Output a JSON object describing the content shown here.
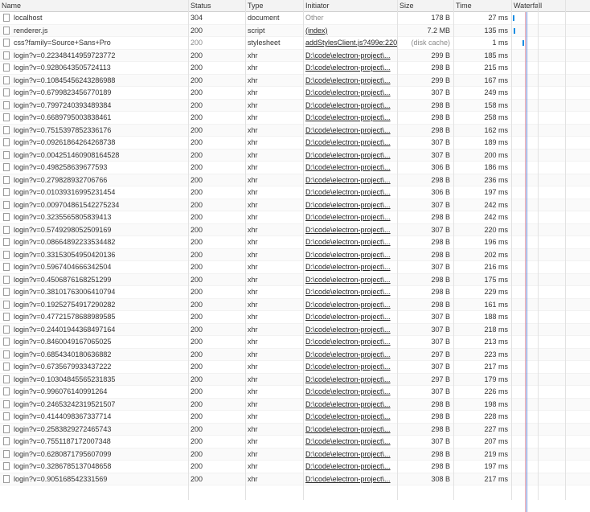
{
  "columns": [
    "Name",
    "Status",
    "Type",
    "Initiator",
    "Size",
    "Time",
    "Waterfall"
  ],
  "requests": [
    {
      "name": "localhost",
      "status": "304",
      "type": "document",
      "initiator": "Other",
      "initiator_link": false,
      "size": "178 B",
      "time": "27 ms"
    },
    {
      "name": "renderer.js",
      "status": "200",
      "type": "script",
      "initiator": "(index)",
      "initiator_link": true,
      "size": "7.2 MB",
      "time": "135 ms"
    },
    {
      "name": "css?family=Source+Sans+Pro",
      "status": "200",
      "type": "stylesheet",
      "initiator": "addStylesClient.js?499e:220",
      "initiator_link": true,
      "size": "(disk cache)",
      "time": "1 ms",
      "muted": true
    },
    {
      "name": "login?v=0.22348414959723772",
      "status": "200",
      "type": "xhr",
      "initiator": "D:\\code\\electron-project\\...",
      "initiator_link": true,
      "size": "299 B",
      "time": "185 ms"
    },
    {
      "name": "login?v=0.9280643505724113",
      "status": "200",
      "type": "xhr",
      "initiator": "D:\\code\\electron-project\\...",
      "initiator_link": true,
      "size": "298 B",
      "time": "215 ms"
    },
    {
      "name": "login?v=0.10845456243286988",
      "status": "200",
      "type": "xhr",
      "initiator": "D:\\code\\electron-project\\...",
      "initiator_link": true,
      "size": "299 B",
      "time": "167 ms"
    },
    {
      "name": "login?v=0.6799823456770189",
      "status": "200",
      "type": "xhr",
      "initiator": "D:\\code\\electron-project\\...",
      "initiator_link": true,
      "size": "307 B",
      "time": "249 ms"
    },
    {
      "name": "login?v=0.7997240393489384",
      "status": "200",
      "type": "xhr",
      "initiator": "D:\\code\\electron-project\\...",
      "initiator_link": true,
      "size": "298 B",
      "time": "158 ms"
    },
    {
      "name": "login?v=0.6689795003838461",
      "status": "200",
      "type": "xhr",
      "initiator": "D:\\code\\electron-project\\...",
      "initiator_link": true,
      "size": "298 B",
      "time": "258 ms"
    },
    {
      "name": "login?v=0.7515397852336176",
      "status": "200",
      "type": "xhr",
      "initiator": "D:\\code\\electron-project\\...",
      "initiator_link": true,
      "size": "298 B",
      "time": "162 ms"
    },
    {
      "name": "login?v=0.09261864264268738",
      "status": "200",
      "type": "xhr",
      "initiator": "D:\\code\\electron-project\\...",
      "initiator_link": true,
      "size": "307 B",
      "time": "189 ms"
    },
    {
      "name": "login?v=0.004251460908164528",
      "status": "200",
      "type": "xhr",
      "initiator": "D:\\code\\electron-project\\...",
      "initiator_link": true,
      "size": "307 B",
      "time": "200 ms"
    },
    {
      "name": "login?v=0.498258639677593",
      "status": "200",
      "type": "xhr",
      "initiator": "D:\\code\\electron-project\\...",
      "initiator_link": true,
      "size": "306 B",
      "time": "186 ms"
    },
    {
      "name": "login?v=0.279828932706766",
      "status": "200",
      "type": "xhr",
      "initiator": "D:\\code\\electron-project\\...",
      "initiator_link": true,
      "size": "298 B",
      "time": "236 ms"
    },
    {
      "name": "login?v=0.01039316995231454",
      "status": "200",
      "type": "xhr",
      "initiator": "D:\\code\\electron-project\\...",
      "initiator_link": true,
      "size": "306 B",
      "time": "197 ms"
    },
    {
      "name": "login?v=0.009704861542275234",
      "status": "200",
      "type": "xhr",
      "initiator": "D:\\code\\electron-project\\...",
      "initiator_link": true,
      "size": "307 B",
      "time": "242 ms"
    },
    {
      "name": "login?v=0.3235565805839413",
      "status": "200",
      "type": "xhr",
      "initiator": "D:\\code\\electron-project\\...",
      "initiator_link": true,
      "size": "298 B",
      "time": "242 ms"
    },
    {
      "name": "login?v=0.5749298052509169",
      "status": "200",
      "type": "xhr",
      "initiator": "D:\\code\\electron-project\\...",
      "initiator_link": true,
      "size": "307 B",
      "time": "220 ms"
    },
    {
      "name": "login?v=0.08664892233534482",
      "status": "200",
      "type": "xhr",
      "initiator": "D:\\code\\electron-project\\...",
      "initiator_link": true,
      "size": "298 B",
      "time": "196 ms"
    },
    {
      "name": "login?v=0.33153054950420136",
      "status": "200",
      "type": "xhr",
      "initiator": "D:\\code\\electron-project\\...",
      "initiator_link": true,
      "size": "298 B",
      "time": "202 ms"
    },
    {
      "name": "login?v=0.5967404666342504",
      "status": "200",
      "type": "xhr",
      "initiator": "D:\\code\\electron-project\\...",
      "initiator_link": true,
      "size": "307 B",
      "time": "216 ms"
    },
    {
      "name": "login?v=0.4506876168251299",
      "status": "200",
      "type": "xhr",
      "initiator": "D:\\code\\electron-project\\...",
      "initiator_link": true,
      "size": "298 B",
      "time": "175 ms"
    },
    {
      "name": "login?v=0.38101763006410794",
      "status": "200",
      "type": "xhr",
      "initiator": "D:\\code\\electron-project\\...",
      "initiator_link": true,
      "size": "298 B",
      "time": "229 ms"
    },
    {
      "name": "login?v=0.19252754917290282",
      "status": "200",
      "type": "xhr",
      "initiator": "D:\\code\\electron-project\\...",
      "initiator_link": true,
      "size": "298 B",
      "time": "161 ms"
    },
    {
      "name": "login?v=0.47721578688989585",
      "status": "200",
      "type": "xhr",
      "initiator": "D:\\code\\electron-project\\...",
      "initiator_link": true,
      "size": "307 B",
      "time": "188 ms"
    },
    {
      "name": "login?v=0.24401944368497164",
      "status": "200",
      "type": "xhr",
      "initiator": "D:\\code\\electron-project\\...",
      "initiator_link": true,
      "size": "307 B",
      "time": "218 ms"
    },
    {
      "name": "login?v=0.8460049167065025",
      "status": "200",
      "type": "xhr",
      "initiator": "D:\\code\\electron-project\\...",
      "initiator_link": true,
      "size": "307 B",
      "time": "213 ms"
    },
    {
      "name": "login?v=0.6854340180636882",
      "status": "200",
      "type": "xhr",
      "initiator": "D:\\code\\electron-project\\...",
      "initiator_link": true,
      "size": "297 B",
      "time": "223 ms"
    },
    {
      "name": "login?v=0.6735679933437222",
      "status": "200",
      "type": "xhr",
      "initiator": "D:\\code\\electron-project\\...",
      "initiator_link": true,
      "size": "307 B",
      "time": "217 ms"
    },
    {
      "name": "login?v=0.10304845565231835",
      "status": "200",
      "type": "xhr",
      "initiator": "D:\\code\\electron-project\\...",
      "initiator_link": true,
      "size": "297 B",
      "time": "179 ms"
    },
    {
      "name": "login?v=0.996076140991264",
      "status": "200",
      "type": "xhr",
      "initiator": "D:\\code\\electron-project\\...",
      "initiator_link": true,
      "size": "307 B",
      "time": "226 ms"
    },
    {
      "name": "login?v=0.24653242319521507",
      "status": "200",
      "type": "xhr",
      "initiator": "D:\\code\\electron-project\\...",
      "initiator_link": true,
      "size": "298 B",
      "time": "198 ms"
    },
    {
      "name": "login?v=0.4144098367337714",
      "status": "200",
      "type": "xhr",
      "initiator": "D:\\code\\electron-project\\...",
      "initiator_link": true,
      "size": "298 B",
      "time": "228 ms"
    },
    {
      "name": "login?v=0.2583829272465743",
      "status": "200",
      "type": "xhr",
      "initiator": "D:\\code\\electron-project\\...",
      "initiator_link": true,
      "size": "298 B",
      "time": "227 ms"
    },
    {
      "name": "login?v=0.7551187172007348",
      "status": "200",
      "type": "xhr",
      "initiator": "D:\\code\\electron-project\\...",
      "initiator_link": true,
      "size": "307 B",
      "time": "207 ms"
    },
    {
      "name": "login?v=0.6280871795607099",
      "status": "200",
      "type": "xhr",
      "initiator": "D:\\code\\electron-project\\...",
      "initiator_link": true,
      "size": "298 B",
      "time": "219 ms"
    },
    {
      "name": "login?v=0.3286785137048658",
      "status": "200",
      "type": "xhr",
      "initiator": "D:\\code\\electron-project\\...",
      "initiator_link": true,
      "size": "298 B",
      "time": "197 ms"
    },
    {
      "name": "login?v=0.905168542331569",
      "status": "200",
      "type": "xhr",
      "initiator": "D:\\code\\electron-project\\...",
      "initiator_link": true,
      "size": "308 B",
      "time": "217 ms"
    }
  ],
  "colors": {
    "header_bg": "#f3f3f3",
    "waterfall_bar": "#1a8de2",
    "waterfall_red_line": "#e0a0b0",
    "waterfall_blue_line": "#6a8ad8"
  }
}
